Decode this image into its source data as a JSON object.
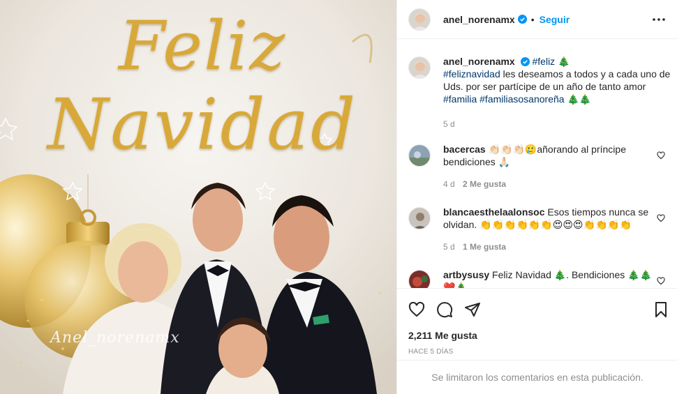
{
  "media": {
    "title_line1": "Feliz",
    "title_line2": "Navidad",
    "watermark": "Anel_norenamx"
  },
  "post": {
    "username": "anel_norenamx",
    "follow_label": "Seguir",
    "caption": {
      "hashtag_feliz": "#feliz",
      "emoji_after_feliz": "🎄",
      "hashtag_feliznavidad": "#feliznavidad",
      "text": " les deseamos a todos y a cada uno de Uds. por ser partícipe de un año de tanto amor ",
      "hashtag_familia": "#familia",
      "hashtag_familiasosanorena": "#familiasosanoreña",
      "trailing_emoji": "🎄🎄",
      "time": "5 d"
    },
    "comments": [
      {
        "username": "bacercas",
        "text": "👏🏻👏🏻👏🏻🥲añorando al príncipe bendiciones 🙏🏻",
        "time": "4 d",
        "likes": "2 Me gusta"
      },
      {
        "username": "blancaesthelaalonsoc",
        "text": "Esos tiempos nunca se olvidan. 👏👏👏👏👏👏😍😍😍👏👏👏👏",
        "time": "5 d",
        "likes": "1 Me gusta"
      },
      {
        "username": "artbysusy",
        "text": "Feliz Navidad 🎄. Bendiciones 🎄🎄❤️🎄",
        "time": "",
        "likes": ""
      }
    ],
    "likes_count": "2,211 Me gusta",
    "time_ago": "HACE 5 DÍAS",
    "comments_limited": "Se limitaron los comentarios en esta publicación."
  },
  "colors": {
    "accent": "#0095f6",
    "hashtag": "#00376b",
    "muted": "#8e8e8e",
    "gold": "#d8a93a"
  },
  "icons": [
    "verified-icon",
    "more-options-icon",
    "heart-icon",
    "comment-icon",
    "share-icon",
    "save-icon"
  ]
}
